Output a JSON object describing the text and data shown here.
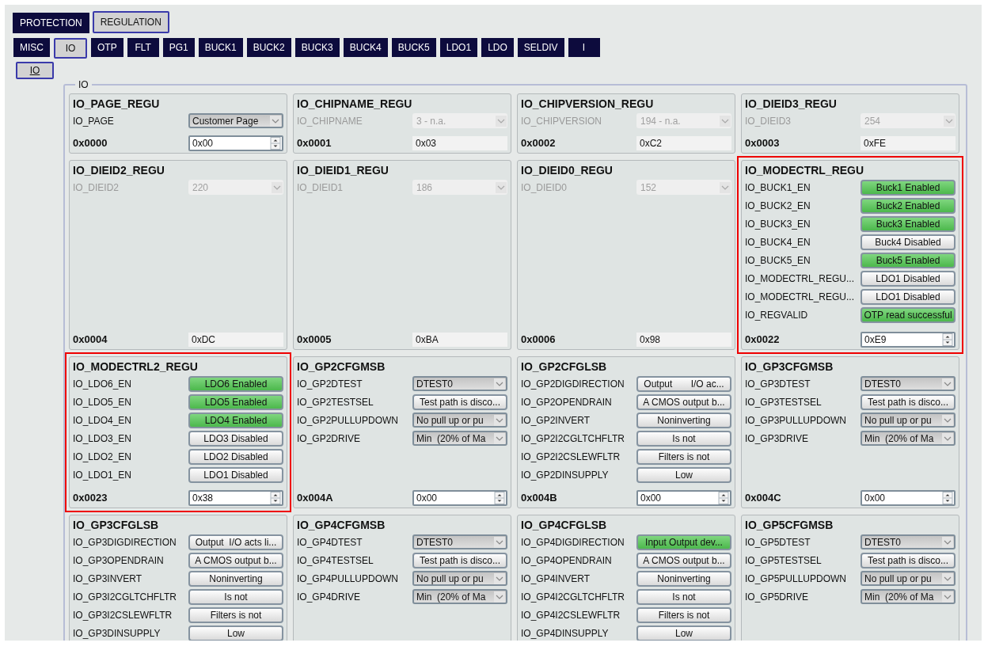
{
  "tabs_level1": [
    {
      "label": "PROTECTION",
      "selected": false
    },
    {
      "label": "REGULATION",
      "selected": true
    }
  ],
  "tabs_level2": [
    {
      "label": "MISC",
      "selected": false
    },
    {
      "label": "IO",
      "selected": true
    },
    {
      "label": "OTP",
      "selected": false
    },
    {
      "label": "FLT",
      "selected": false
    },
    {
      "label": "PG1",
      "selected": false
    },
    {
      "label": "BUCK1",
      "selected": false
    },
    {
      "label": "BUCK2",
      "selected": false
    },
    {
      "label": "BUCK3",
      "selected": false
    },
    {
      "label": "BUCK4",
      "selected": false
    },
    {
      "label": "BUCK5",
      "selected": false
    },
    {
      "label": "LDO1",
      "selected": false
    },
    {
      "label": "LDO",
      "selected": false
    },
    {
      "label": "SELDIV",
      "selected": false
    },
    {
      "label": "I",
      "selected": false
    }
  ],
  "tabs_level3": [
    {
      "label": "IO",
      "selected": true
    }
  ],
  "group": {
    "title": "IO"
  },
  "registers": [
    {
      "title": "IO_PAGE_REGU",
      "highlighted": false,
      "rows": [
        {
          "kind": "combo",
          "label": "IO_PAGE",
          "value": "Customer Page",
          "disabled": false
        }
      ],
      "footer": {
        "address": "0x0000",
        "value": "0x00",
        "editable": true
      }
    },
    {
      "title": "IO_CHIPNAME_REGU",
      "highlighted": false,
      "rows": [
        {
          "kind": "combo",
          "label": "IO_CHIPNAME",
          "value": "3 - n.a.",
          "disabled": true
        }
      ],
      "footer": {
        "address": "0x0001",
        "value": "0x03",
        "editable": false
      }
    },
    {
      "title": "IO_CHIPVERSION_REGU",
      "highlighted": false,
      "rows": [
        {
          "kind": "combo",
          "label": "IO_CHIPVERSION",
          "value": "194 - n.a.",
          "disabled": true
        }
      ],
      "footer": {
        "address": "0x0002",
        "value": "0xC2",
        "editable": false
      }
    },
    {
      "title": "IO_DIEID3_REGU",
      "highlighted": false,
      "rows": [
        {
          "kind": "combo",
          "label": "IO_DIEID3",
          "value": "254",
          "disabled": true
        }
      ],
      "footer": {
        "address": "0x0003",
        "value": "0xFE",
        "editable": false
      }
    },
    {
      "title": "IO_DIEID2_REGU",
      "highlighted": false,
      "rows": [
        {
          "kind": "combo",
          "label": "IO_DIEID2",
          "value": "220",
          "disabled": true
        }
      ],
      "footer": {
        "address": "0x0004",
        "value": "0xDC",
        "editable": false
      }
    },
    {
      "title": "IO_DIEID1_REGU",
      "highlighted": false,
      "rows": [
        {
          "kind": "combo",
          "label": "IO_DIEID1",
          "value": "186",
          "disabled": true
        }
      ],
      "footer": {
        "address": "0x0005",
        "value": "0xBA",
        "editable": false
      }
    },
    {
      "title": "IO_DIEID0_REGU",
      "highlighted": false,
      "rows": [
        {
          "kind": "combo",
          "label": "IO_DIEID0",
          "value": "152",
          "disabled": true
        }
      ],
      "footer": {
        "address": "0x0006",
        "value": "0x98",
        "editable": false
      }
    },
    {
      "title": "IO_MODECTRL_REGU",
      "highlighted": true,
      "rows": [
        {
          "kind": "button",
          "label": "IO_BUCK1_EN",
          "value": "Buck1 Enabled",
          "on": true
        },
        {
          "kind": "button",
          "label": "IO_BUCK2_EN",
          "value": "Buck2 Enabled",
          "on": true
        },
        {
          "kind": "button",
          "label": "IO_BUCK3_EN",
          "value": "Buck3 Enabled",
          "on": true
        },
        {
          "kind": "button",
          "label": "IO_BUCK4_EN",
          "value": "Buck4 Disabled",
          "on": false
        },
        {
          "kind": "button",
          "label": "IO_BUCK5_EN",
          "value": "Buck5 Enabled",
          "on": true
        },
        {
          "kind": "button",
          "label": "IO_MODECTRL_REGU...",
          "value": "LDO1 Disabled",
          "on": false
        },
        {
          "kind": "button",
          "label": "IO_MODECTRL_REGU...",
          "value": "LDO1 Disabled",
          "on": false
        },
        {
          "kind": "button",
          "label": "IO_REGVALID",
          "value": "OTP read successful",
          "on": true
        }
      ],
      "footer": {
        "address": "0x0022",
        "value": "0xE9",
        "editable": true
      }
    },
    {
      "title": "IO_MODECTRL2_REGU",
      "highlighted": true,
      "rows": [
        {
          "kind": "button",
          "label": "IO_LDO6_EN",
          "value": "LDO6 Enabled",
          "on": true
        },
        {
          "kind": "button",
          "label": "IO_LDO5_EN",
          "value": "LDO5 Enabled",
          "on": true
        },
        {
          "kind": "button",
          "label": "IO_LDO4_EN",
          "value": "LDO4 Enabled",
          "on": true
        },
        {
          "kind": "button",
          "label": "IO_LDO3_EN",
          "value": "LDO3 Disabled",
          "on": false
        },
        {
          "kind": "button",
          "label": "IO_LDO2_EN",
          "value": "LDO2 Disabled",
          "on": false
        },
        {
          "kind": "button",
          "label": "IO_LDO1_EN",
          "value": "LDO1 Disabled",
          "on": false
        }
      ],
      "footer": {
        "address": "0x0023",
        "value": "0x38",
        "editable": true
      }
    },
    {
      "title": "IO_GP2CFGMSB",
      "highlighted": false,
      "rows": [
        {
          "kind": "combo",
          "label": "IO_GP2DTEST",
          "value": "DTEST0",
          "disabled": false
        },
        {
          "kind": "button",
          "label": "IO_GP2TESTSEL",
          "value": "Test path is disco...",
          "on": false
        },
        {
          "kind": "combo",
          "label": "IO_GP2PULLUPDOWN",
          "value": "No pull up or pu",
          "disabled": false
        },
        {
          "kind": "combo",
          "label": "IO_GP2DRIVE",
          "value": "Min  (20% of Ma",
          "disabled": false
        }
      ],
      "footer": {
        "address": "0x004A",
        "value": "0x00",
        "editable": true
      }
    },
    {
      "title": "IO_GP2CFGLSB",
      "highlighted": false,
      "rows": [
        {
          "kind": "button",
          "label": "IO_GP2DIGDIRECTION",
          "value": "Output       I/O ac...",
          "on": false
        },
        {
          "kind": "button",
          "label": "IO_GP2OPENDRAIN",
          "value": "A CMOS output b...",
          "on": false
        },
        {
          "kind": "button",
          "label": "IO_GP2INVERT",
          "value": "Noninverting",
          "on": false
        },
        {
          "kind": "button",
          "label": "IO_GP2I2CGLTCHFLTR",
          "value": "Is not",
          "on": false
        },
        {
          "kind": "button",
          "label": "IO_GP2I2CSLEWFLTR",
          "value": "Filters is not",
          "on": false
        },
        {
          "kind": "button",
          "label": "IO_GP2DINSUPPLY",
          "value": "Low",
          "on": false
        }
      ],
      "footer": {
        "address": "0x004B",
        "value": "0x00",
        "editable": true
      }
    },
    {
      "title": "IO_GP3CFGMSB",
      "highlighted": false,
      "rows": [
        {
          "kind": "combo",
          "label": "IO_GP3DTEST",
          "value": "DTEST0",
          "disabled": false
        },
        {
          "kind": "button",
          "label": "IO_GP3TESTSEL",
          "value": "Test path is disco...",
          "on": false
        },
        {
          "kind": "combo",
          "label": "IO_GP3PULLUPDOWN",
          "value": "No pull up or pu",
          "disabled": false
        },
        {
          "kind": "combo",
          "label": "IO_GP3DRIVE",
          "value": "Min  (20% of Ma",
          "disabled": false
        }
      ],
      "footer": {
        "address": "0x004C",
        "value": "0x00",
        "editable": true
      }
    },
    {
      "title": "IO_GP3CFGLSB",
      "highlighted": false,
      "rows": [
        {
          "kind": "button",
          "label": "IO_GP3DIGDIRECTION",
          "value": "Output  I/O acts li...",
          "on": false
        },
        {
          "kind": "button",
          "label": "IO_GP3OPENDRAIN",
          "value": "A CMOS output b...",
          "on": false
        },
        {
          "kind": "button",
          "label": "IO_GP3INVERT",
          "value": "Noninverting",
          "on": false
        },
        {
          "kind": "button",
          "label": "IO_GP3I2CGLTCHFLTR",
          "value": "Is not",
          "on": false
        },
        {
          "kind": "button",
          "label": "IO_GP3I2CSLEWFLTR",
          "value": "Filters is not",
          "on": false
        },
        {
          "kind": "button",
          "label": "IO_GP3DINSUPPLY",
          "value": "Low",
          "on": false
        }
      ]
    },
    {
      "title": "IO_GP4CFGMSB",
      "highlighted": false,
      "rows": [
        {
          "kind": "combo",
          "label": "IO_GP4DTEST",
          "value": "DTEST0",
          "disabled": false
        },
        {
          "kind": "button",
          "label": "IO_GP4TESTSEL",
          "value": "Test path is disco...",
          "on": false
        },
        {
          "kind": "combo",
          "label": "IO_GP4PULLUPDOWN",
          "value": "No pull up or pu",
          "disabled": false
        },
        {
          "kind": "combo",
          "label": "IO_GP4DRIVE",
          "value": "Min  (20% of Ma",
          "disabled": false
        }
      ]
    },
    {
      "title": "IO_GP4CFGLSB",
      "highlighted": false,
      "rows": [
        {
          "kind": "button",
          "label": "IO_GP4DIGDIRECTION",
          "value": "Input Output dev...",
          "on": true
        },
        {
          "kind": "button",
          "label": "IO_GP4OPENDRAIN",
          "value": "A CMOS output b...",
          "on": false
        },
        {
          "kind": "button",
          "label": "IO_GP4INVERT",
          "value": "Noninverting",
          "on": false
        },
        {
          "kind": "button",
          "label": "IO_GP4I2CGLTCHFLTR",
          "value": "Is not",
          "on": false
        },
        {
          "kind": "button",
          "label": "IO_GP4I2CSLEWFLTR",
          "value": "Filters is not",
          "on": false
        },
        {
          "kind": "button",
          "label": "IO_GP4DINSUPPLY",
          "value": "Low",
          "on": false
        }
      ]
    },
    {
      "title": "IO_GP5CFGMSB",
      "highlighted": false,
      "rows": [
        {
          "kind": "combo",
          "label": "IO_GP5DTEST",
          "value": "DTEST0",
          "disabled": false
        },
        {
          "kind": "button",
          "label": "IO_GP5TESTSEL",
          "value": "Test path is disco...",
          "on": false
        },
        {
          "kind": "combo",
          "label": "IO_GP5PULLUPDOWN",
          "value": "No pull up or pu",
          "disabled": false
        },
        {
          "kind": "combo",
          "label": "IO_GP5DRIVE",
          "value": "Min  (20% of Ma",
          "disabled": false
        }
      ]
    }
  ]
}
